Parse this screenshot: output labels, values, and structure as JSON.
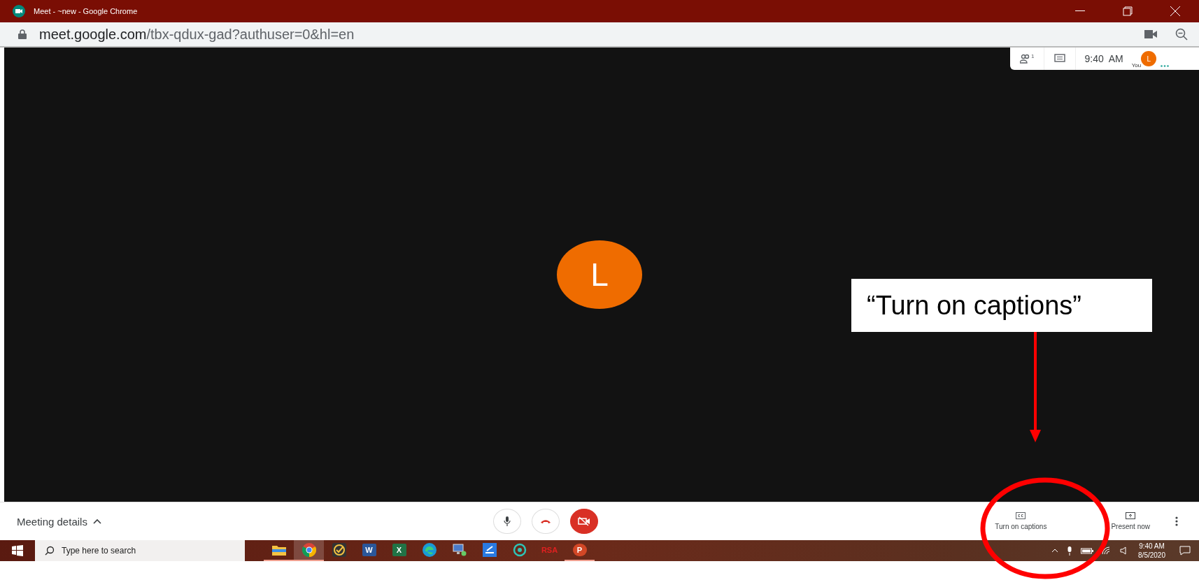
{
  "window": {
    "title": "Meet - ~new - Google Chrome"
  },
  "address_bar": {
    "host": "meet.google.com",
    "path": "/tbx-qdux-gad?authuser=0&hl=en"
  },
  "meeting_header": {
    "participant_count": "1",
    "time": "9:40  AM",
    "self_label": "You",
    "self_initial": "L"
  },
  "video": {
    "participant_initial": "L"
  },
  "bottom_bar": {
    "details": "Meeting details",
    "camera_on": false,
    "captions_label": "Turn on captions",
    "present_label": "Present now"
  },
  "taskbar": {
    "search_placeholder": "Type here to search",
    "apps": [
      {
        "kind": "explorer",
        "selected": false,
        "running": true
      },
      {
        "kind": "chrome",
        "selected": true,
        "running": true
      },
      {
        "kind": "check",
        "selected": false,
        "running": false
      },
      {
        "kind": "word",
        "label": "W",
        "selected": false,
        "running": false
      },
      {
        "kind": "excel",
        "label": "X",
        "selected": false,
        "running": false
      },
      {
        "kind": "edge",
        "selected": false,
        "running": false
      },
      {
        "kind": "remote",
        "selected": false,
        "running": false
      },
      {
        "kind": "scan",
        "selected": false,
        "running": false
      },
      {
        "kind": "ring",
        "selected": false,
        "running": false
      },
      {
        "kind": "rsa",
        "label": "RSA",
        "selected": false,
        "running": false
      },
      {
        "kind": "powerpoint",
        "label": "P",
        "selected": false,
        "running": true
      }
    ],
    "time": "9:40 AM",
    "date": "8/5/2020"
  },
  "annotation": {
    "text": "“Turn on captions”"
  }
}
